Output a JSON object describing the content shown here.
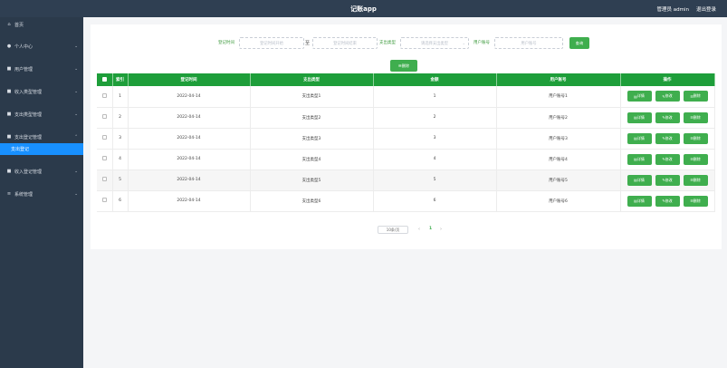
{
  "header": {
    "title": "记账app",
    "admin_label": "管理员 admin",
    "logout_label": "退出登录"
  },
  "sidebar": {
    "items": [
      {
        "label": "首页",
        "icon": "home-icon",
        "glyph": "⌂"
      },
      {
        "label": "个人中心",
        "icon": "user-icon",
        "glyph": "●"
      },
      {
        "label": "用户管理",
        "icon": "users-icon",
        "glyph": "■"
      },
      {
        "label": "收入类型管理",
        "icon": "grid-icon",
        "glyph": "■"
      },
      {
        "label": "支出类型管理",
        "icon": "grid-icon",
        "glyph": "■"
      },
      {
        "label": "支出登记管理",
        "icon": "doc-icon",
        "glyph": "■"
      },
      {
        "label": "收入登记管理",
        "icon": "grid-icon",
        "glyph": "■"
      },
      {
        "label": "系统管理",
        "icon": "list-icon",
        "glyph": "≡"
      }
    ],
    "active_sub": "支出登记"
  },
  "search": {
    "time_label": "登记时间",
    "start_placeholder": "登记时间开始",
    "to_label": "至",
    "end_placeholder": "登记时间结束",
    "type_label": "支出类型",
    "type_placeholder": "请选择支出类型",
    "account_label": "用户账号",
    "account_placeholder": "用户账号",
    "search_button": "查询",
    "delete_button": "删除"
  },
  "table": {
    "headers": [
      "索引",
      "登记时间",
      "支出类型",
      "金额",
      "用户账号",
      "操作"
    ],
    "rows": [
      {
        "index": "1",
        "time": "2022-04-14",
        "type": "支出类型1",
        "amount": "1",
        "account": "用户账号1"
      },
      {
        "index": "2",
        "time": "2022-04-14",
        "type": "支出类型2",
        "amount": "2",
        "account": "用户账号2"
      },
      {
        "index": "3",
        "time": "2022-04-14",
        "type": "支出类型3",
        "amount": "3",
        "account": "用户账号3"
      },
      {
        "index": "4",
        "time": "2022-04-14",
        "type": "支出类型4",
        "amount": "4",
        "account": "用户账号4"
      },
      {
        "index": "5",
        "time": "2022-04-14",
        "type": "支出类型5",
        "amount": "5",
        "account": "用户账号5"
      },
      {
        "index": "6",
        "time": "2022-04-14",
        "type": "支出类型6",
        "amount": "6",
        "account": "用户账号6"
      }
    ],
    "op_detail": "详情",
    "op_edit": "修改",
    "op_delete": "删除"
  },
  "pager": {
    "page_size": "10条/页",
    "current_page": "1"
  },
  "colors": {
    "topbar": "#2f3f52",
    "sidebar": "#2b3a4b",
    "accent_blue": "#1890ff",
    "accent_green": "#1e9e3a",
    "button_green": "#3fae4e"
  }
}
